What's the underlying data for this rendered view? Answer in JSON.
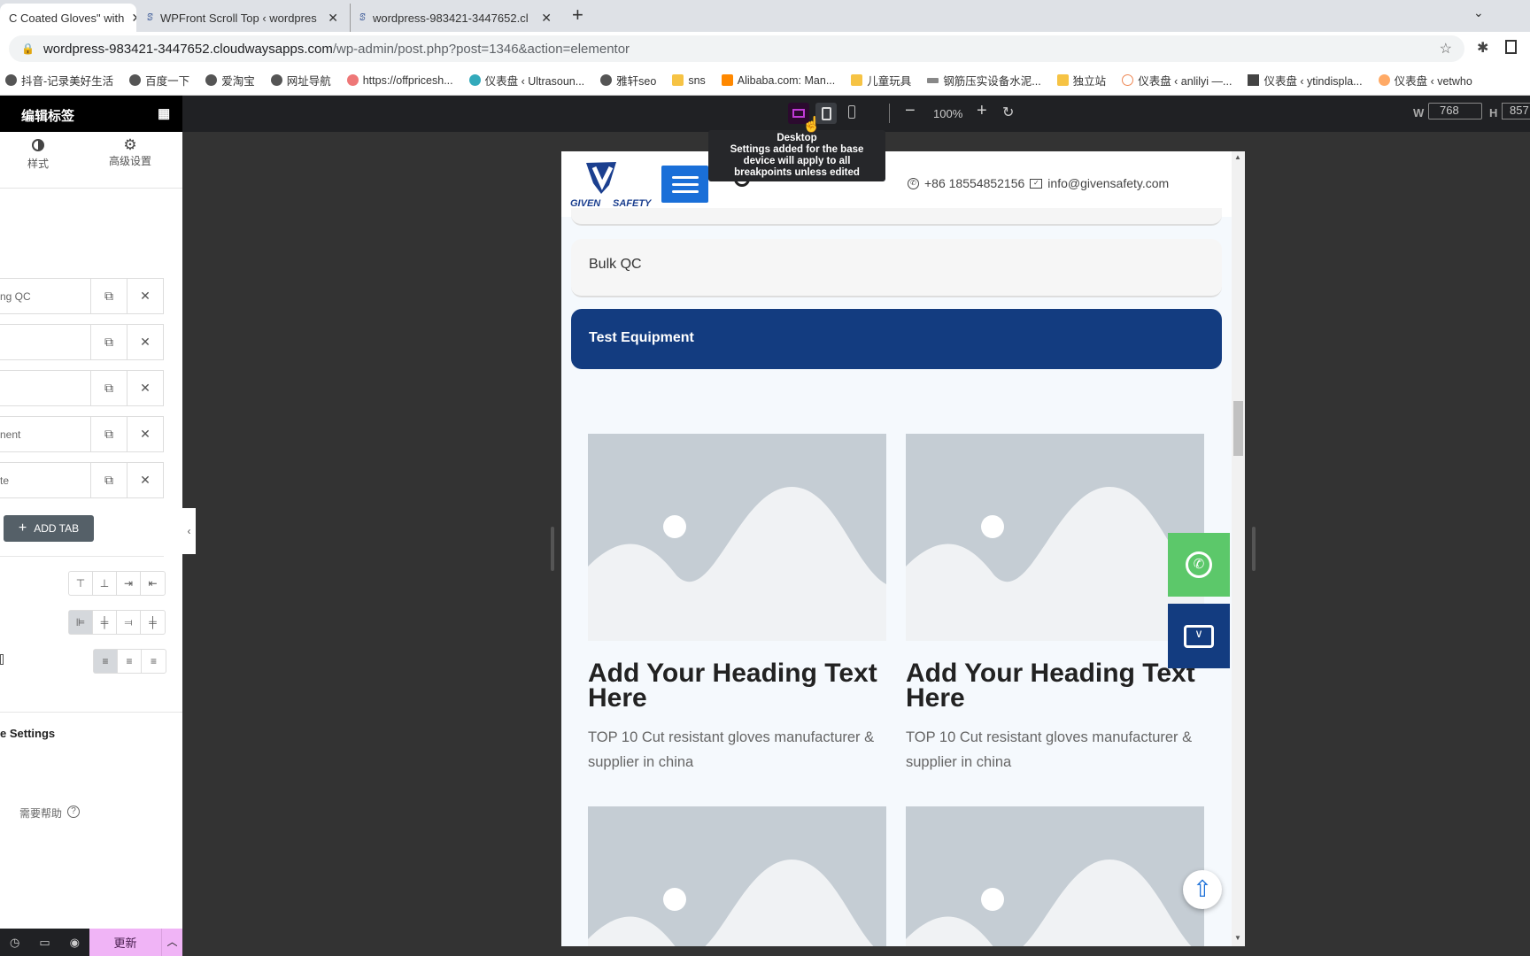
{
  "browser": {
    "tabs": [
      {
        "title": "C Coated Gloves\" with"
      },
      {
        "title": "WPFront Scroll Top ‹ wordpres"
      },
      {
        "title": "wordpress-983421-3447652.cl"
      }
    ],
    "url_host": "wordpress-983421-3447652.cloudwaysapps.com",
    "url_path": "/wp-admin/post.php?post=1346&action=elementor",
    "bookmarks": [
      "抖音-记录美好生活",
      "百度一下",
      "爱淘宝",
      "网址导航",
      "https://offpricesh...",
      "仪表盘 ‹ Ultrasoun...",
      "雅轩seo",
      "sns",
      "Alibaba.com: Man...",
      "儿童玩具",
      "钢筋压实设备水泥...",
      "独立站",
      "仪表盘 ‹ anlilyi —...",
      "仪表盘 ‹ ytindispla...",
      "仪表盘 ‹ vetwho"
    ]
  },
  "sidebar": {
    "title": "编辑标签",
    "tabs": [
      {
        "label": "样式"
      },
      {
        "label": "高级设置"
      }
    ],
    "items": [
      {
        "label": "ng QC"
      },
      {
        "label": ""
      },
      {
        "label": ""
      },
      {
        "label": "nent"
      },
      {
        "label": "te"
      }
    ],
    "add_tab": "ADD TAB",
    "section": "e Settings",
    "help": "需要帮助",
    "update": "更新"
  },
  "topbar": {
    "zoom": "100%",
    "w_label": "W",
    "w": "768",
    "h_label": "H",
    "h": "857",
    "tooltip_title": "Desktop",
    "tooltip_body": "Settings added for the base device will apply to all breakpoints unless edited"
  },
  "preview": {
    "logo": "GIVEN SAFETY",
    "phone": "+86 18554852156",
    "email": "info@givensafety.com",
    "accordion": [
      {
        "label": "Bulk QC"
      },
      {
        "label": "Test Equipment",
        "active": true
      }
    ],
    "cards": [
      {
        "heading": "Add Your Heading Text Here",
        "text": "TOP 10 Cut resistant gloves manufacturer & supplier in china"
      },
      {
        "heading": "Add Your Heading Text Here",
        "text": "TOP 10 Cut resistant gloves manufacturer & supplier in china"
      }
    ],
    "colors": {
      "accent": "#133c80",
      "whatsapp": "#5cc86a",
      "menu": "#1a6fd8"
    }
  }
}
